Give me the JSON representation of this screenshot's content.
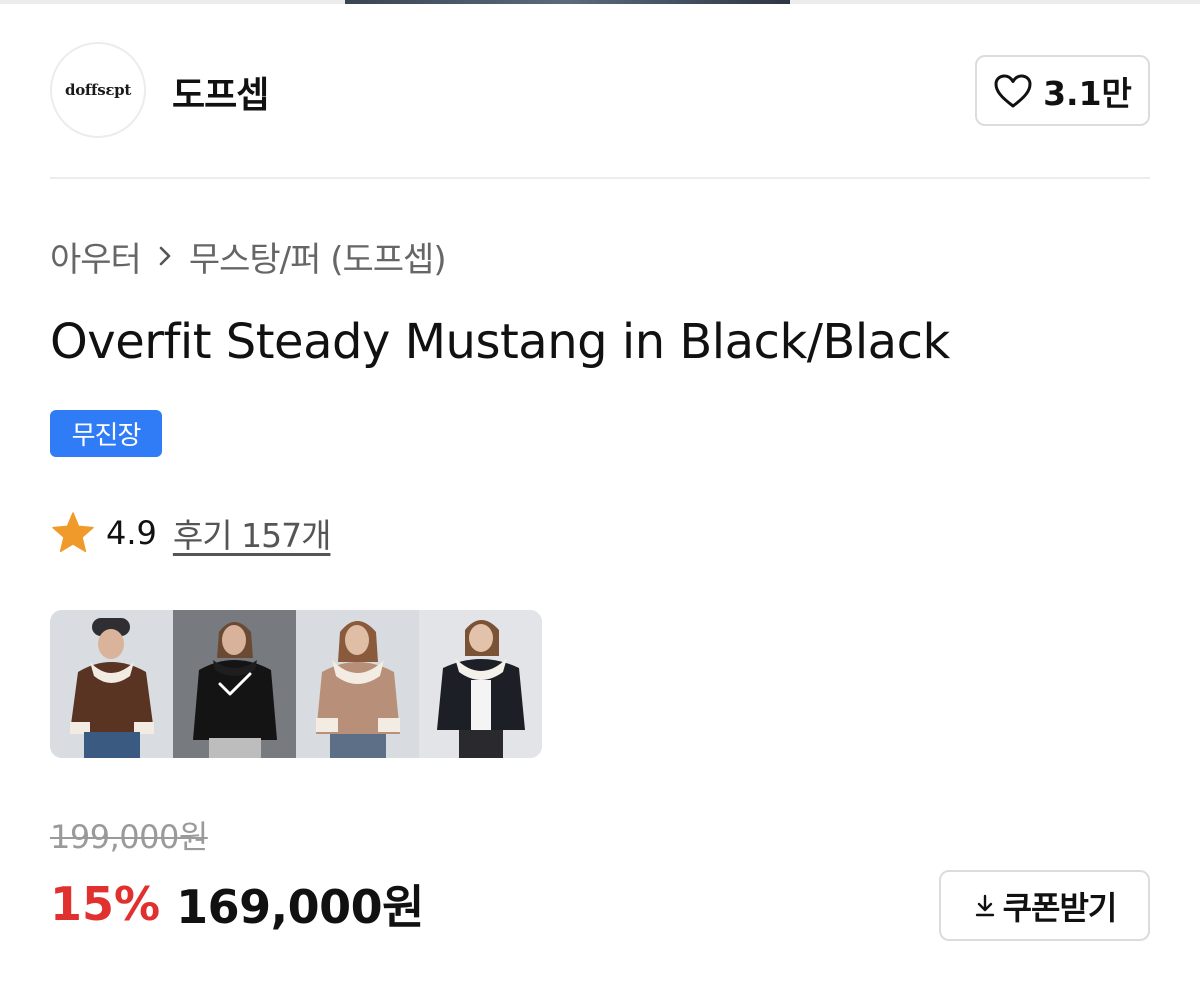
{
  "brand": {
    "logo_text": "doffsεpt",
    "name": "도프셉",
    "likes": "3.1만"
  },
  "breadcrumb": {
    "parent": "아우터",
    "current": "무스탕/퍼 (도프셉)"
  },
  "product": {
    "title": "Overfit Steady Mustang in Black/Black",
    "badge": "무진장"
  },
  "rating": {
    "score": "4.9",
    "reviews": "후기 157개"
  },
  "color_options": [
    {
      "name": "brown",
      "selected": false
    },
    {
      "name": "black",
      "selected": true
    },
    {
      "name": "beige",
      "selected": false
    },
    {
      "name": "black-white-collar",
      "selected": false
    }
  ],
  "pricing": {
    "original": "199,000원",
    "discount": "15%",
    "sale": "169,000원"
  },
  "coupon": {
    "label": "쿠폰받기"
  },
  "colors": {
    "badge": "#2f7cf6",
    "discount": "#e0312f",
    "star": "#f19a2c"
  }
}
